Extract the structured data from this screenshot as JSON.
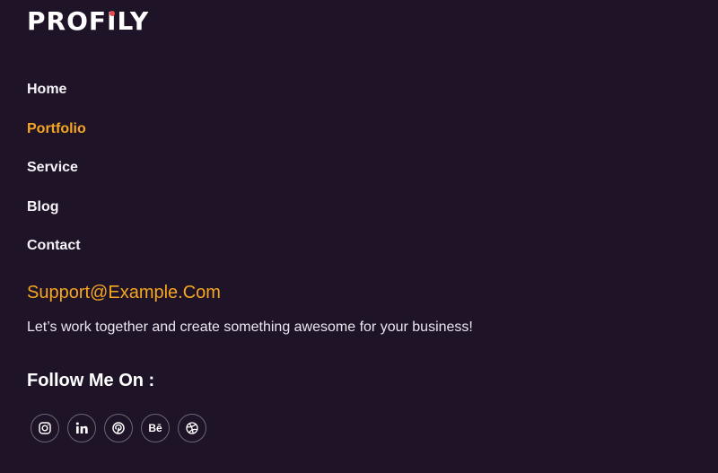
{
  "brand": {
    "logo_before": "PRO",
    "logo_i": "I",
    "logo_f": "F",
    "logo_after": "LY",
    "accent_dot_color": "#e64a4a"
  },
  "nav": {
    "items": [
      {
        "label": "Home",
        "active": false
      },
      {
        "label": "Portfolio",
        "active": true
      },
      {
        "label": "Service",
        "active": false
      },
      {
        "label": "Blog",
        "active": false
      },
      {
        "label": "Contact",
        "active": false
      }
    ]
  },
  "contact": {
    "email": "Support@Example.Com",
    "tagline": "Let’s work together and create something awesome for your business!"
  },
  "follow": {
    "heading": "Follow Me On :",
    "socials": [
      {
        "name": "instagram-icon"
      },
      {
        "name": "linkedin-icon"
      },
      {
        "name": "pinterest-icon"
      },
      {
        "name": "behance-icon",
        "glyph": "Bē"
      },
      {
        "name": "dribbble-icon"
      }
    ]
  },
  "colors": {
    "background": "#1f1427",
    "accent": "#f5a623",
    "text": "#ffffff"
  }
}
